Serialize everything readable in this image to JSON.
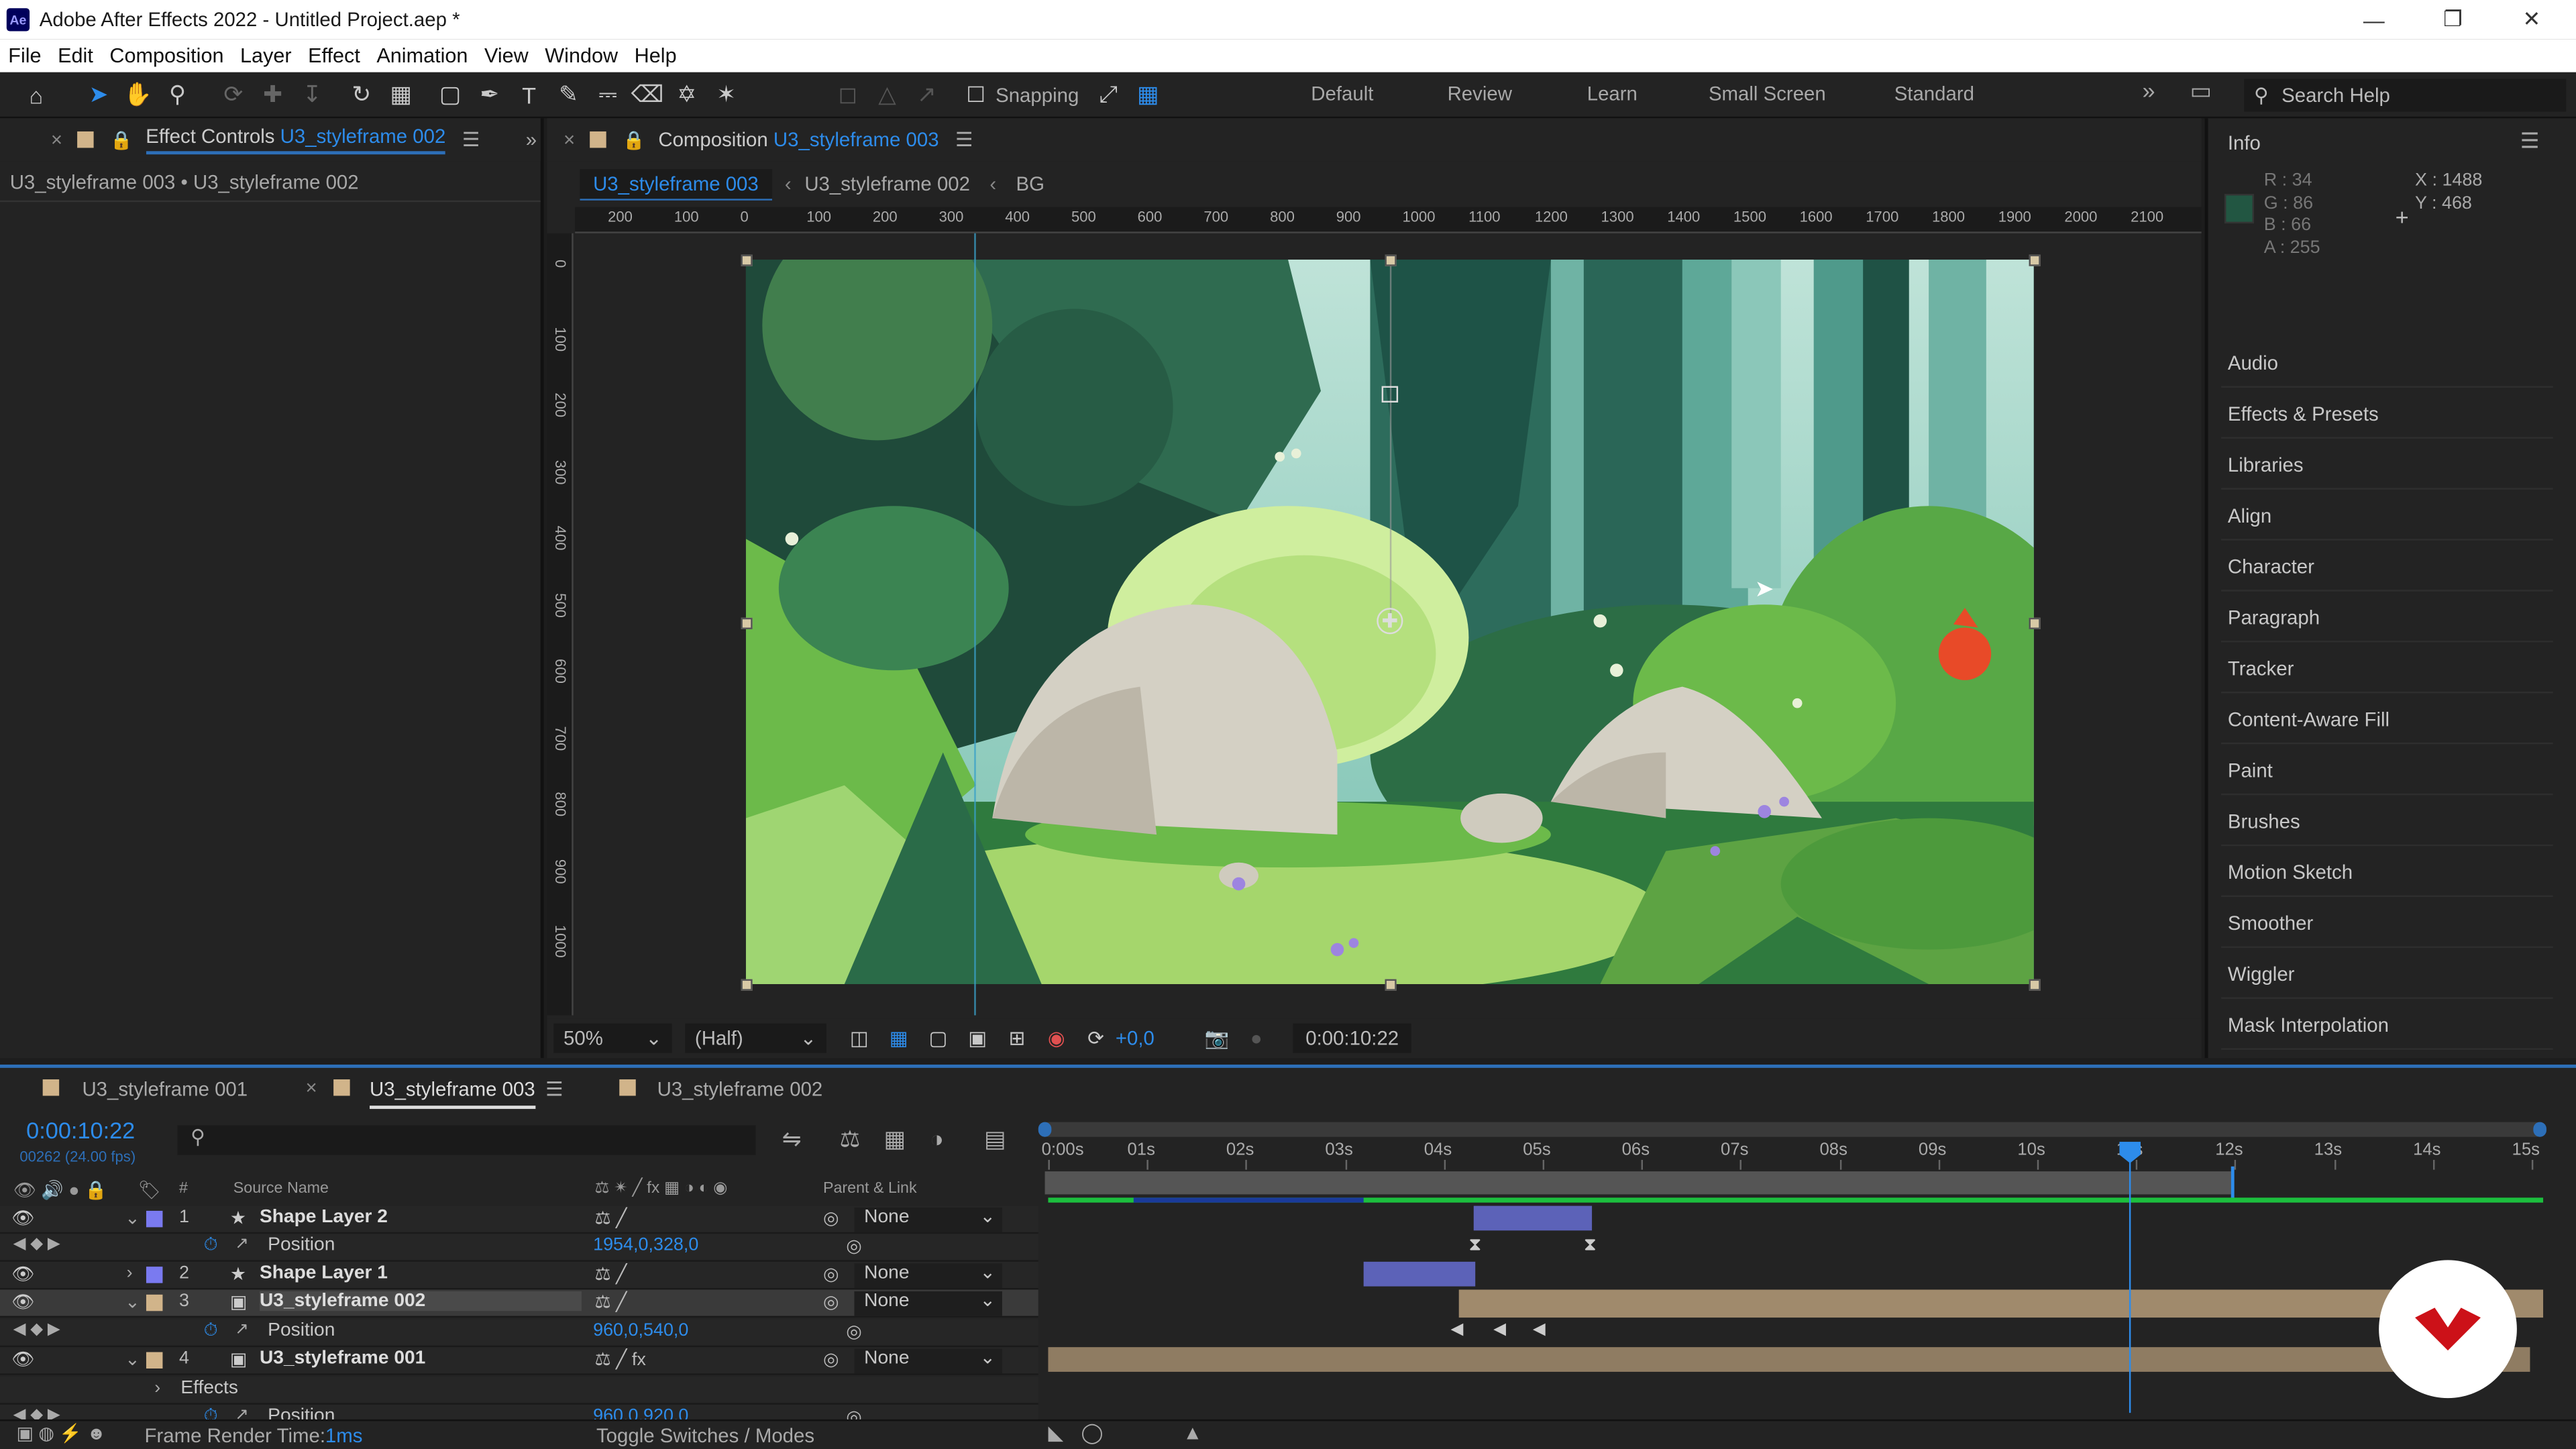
{
  "window": {
    "title": "Adobe After Effects 2022 - Untitled Project.aep *",
    "app_badge": "Ae"
  },
  "menu": [
    "File",
    "Edit",
    "Composition",
    "Layer",
    "Effect",
    "Animation",
    "View",
    "Window",
    "Help"
  ],
  "toolbar": {
    "snapping_label": "Snapping",
    "workspaces": [
      "Default",
      "Review",
      "Learn",
      "Small Screen",
      "Standard"
    ],
    "search_placeholder": "Search Help"
  },
  "effect_controls": {
    "tab_prefix": "Effect Controls",
    "tab_layer": "U3_styleframe 002",
    "breadcrumb": "U3_styleframe 003 • U3_styleframe 002"
  },
  "composition": {
    "tab_prefix": "Composition",
    "tab_comp": "U3_styleframe 003",
    "flow": [
      "U3_styleframe 003",
      "U3_styleframe 002",
      "BG"
    ],
    "ruler_labels": [
      "200",
      "100",
      "0",
      "100",
      "200",
      "300",
      "400",
      "500",
      "600",
      "700",
      "800",
      "900",
      "1000",
      "1100",
      "1200",
      "1300",
      "1400",
      "1500",
      "1600",
      "1700",
      "1800",
      "1900",
      "2000",
      "2100"
    ],
    "ruler_v_labels": [
      "0",
      "100",
      "200",
      "300",
      "400",
      "500",
      "600",
      "700",
      "800",
      "900",
      "1000"
    ],
    "zoom": "50%",
    "resolution": "(Half)",
    "exposure": "+0,0",
    "timecode": "0:00:10:22"
  },
  "info": {
    "title": "Info",
    "color_hex": "#225642",
    "r": "R : 34",
    "g": "G : 86",
    "b": "B : 66",
    "a": "A : 255",
    "x": "X : 1488",
    "y": "Y : 468"
  },
  "right_panels": [
    "Audio",
    "Effects & Presets",
    "Libraries",
    "Align",
    "Character",
    "Paragraph",
    "Tracker",
    "Content-Aware Fill",
    "Paint",
    "Brushes",
    "Motion Sketch",
    "Smoother",
    "Wiggler",
    "Mask Interpolation"
  ],
  "timeline": {
    "tabs": [
      "U3_styleframe 001",
      "U3_styleframe 003",
      "U3_styleframe 002"
    ],
    "timecode": "0:00:10:22",
    "frame_info": "00262 (24.00 fps)",
    "col_source": "Source Name",
    "col_parent": "Parent & Link",
    "col_hash": "#",
    "time_ticks": [
      "0:00s",
      "01s",
      "02s",
      "03s",
      "04s",
      "05s",
      "06s",
      "07s",
      "08s",
      "09s",
      "10s",
      "11s",
      "12s",
      "13s",
      "14s",
      "15s"
    ],
    "layers": [
      {
        "num": "1",
        "name": "Shape Layer 2",
        "parent": "None",
        "color": "#7a7af0",
        "prop": "Position",
        "prop_value": "1954,0,328,0"
      },
      {
        "num": "2",
        "name": "Shape Layer 1",
        "parent": "None",
        "color": "#7a7af0"
      },
      {
        "num": "3",
        "name": "U3_styleframe 002",
        "parent": "None",
        "color": "#d1b48a",
        "prop": "Position",
        "prop_value": "960,0,540,0"
      },
      {
        "num": "4",
        "name": "U3_styleframe 001",
        "parent": "None",
        "color": "#d1b48a",
        "effects_label": "Effects",
        "prop": "Position",
        "prop_value": "960,0,920,0"
      }
    ],
    "footer_render": "Frame Render Time:",
    "footer_render_value": "1ms",
    "footer_toggle": "Toggle Switches / Modes"
  }
}
